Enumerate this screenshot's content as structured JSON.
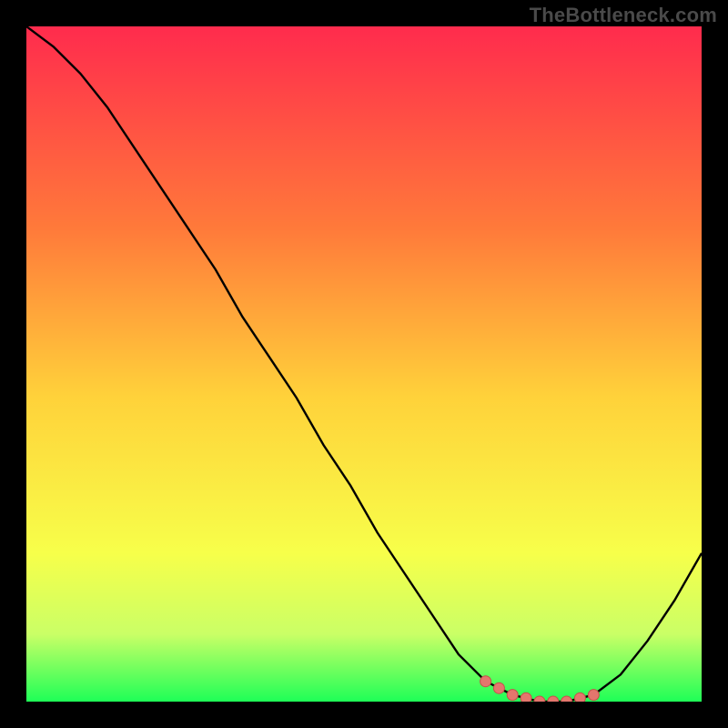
{
  "watermark": "TheBottleneck.com",
  "colors": {
    "bg_black": "#000000",
    "grad_top": "#ff2b4d",
    "grad_mid1": "#ff7a3a",
    "grad_mid2": "#ffd23a",
    "grad_mid3": "#f7ff4a",
    "grad_mid4": "#caff66",
    "grad_bottom": "#1eff57",
    "curve": "#000000",
    "marker_fill": "#e4766d",
    "marker_stroke": "#c64f49"
  },
  "chart_data": {
    "type": "line",
    "title": "",
    "xlabel": "",
    "ylabel": "",
    "xlim": [
      0,
      100
    ],
    "ylim": [
      0,
      100
    ],
    "grid": false,
    "legend": false,
    "series": [
      {
        "name": "bottleneck-curve",
        "x": [
          0,
          4,
          8,
          12,
          16,
          20,
          24,
          28,
          32,
          36,
          40,
          44,
          48,
          52,
          56,
          60,
          64,
          68,
          72,
          76,
          80,
          84,
          88,
          92,
          96,
          100
        ],
        "y": [
          100,
          97,
          93,
          88,
          82,
          76,
          70,
          64,
          57,
          51,
          45,
          38,
          32,
          25,
          19,
          13,
          7,
          3,
          1,
          0,
          0,
          1,
          4,
          9,
          15,
          22
        ]
      }
    ],
    "markers": {
      "name": "optimal-range-markers",
      "points": [
        {
          "x": 68,
          "y": 3
        },
        {
          "x": 70,
          "y": 2
        },
        {
          "x": 72,
          "y": 1
        },
        {
          "x": 74,
          "y": 0.5
        },
        {
          "x": 76,
          "y": 0
        },
        {
          "x": 78,
          "y": 0
        },
        {
          "x": 80,
          "y": 0
        },
        {
          "x": 82,
          "y": 0.5
        },
        {
          "x": 84,
          "y": 1
        }
      ]
    }
  }
}
